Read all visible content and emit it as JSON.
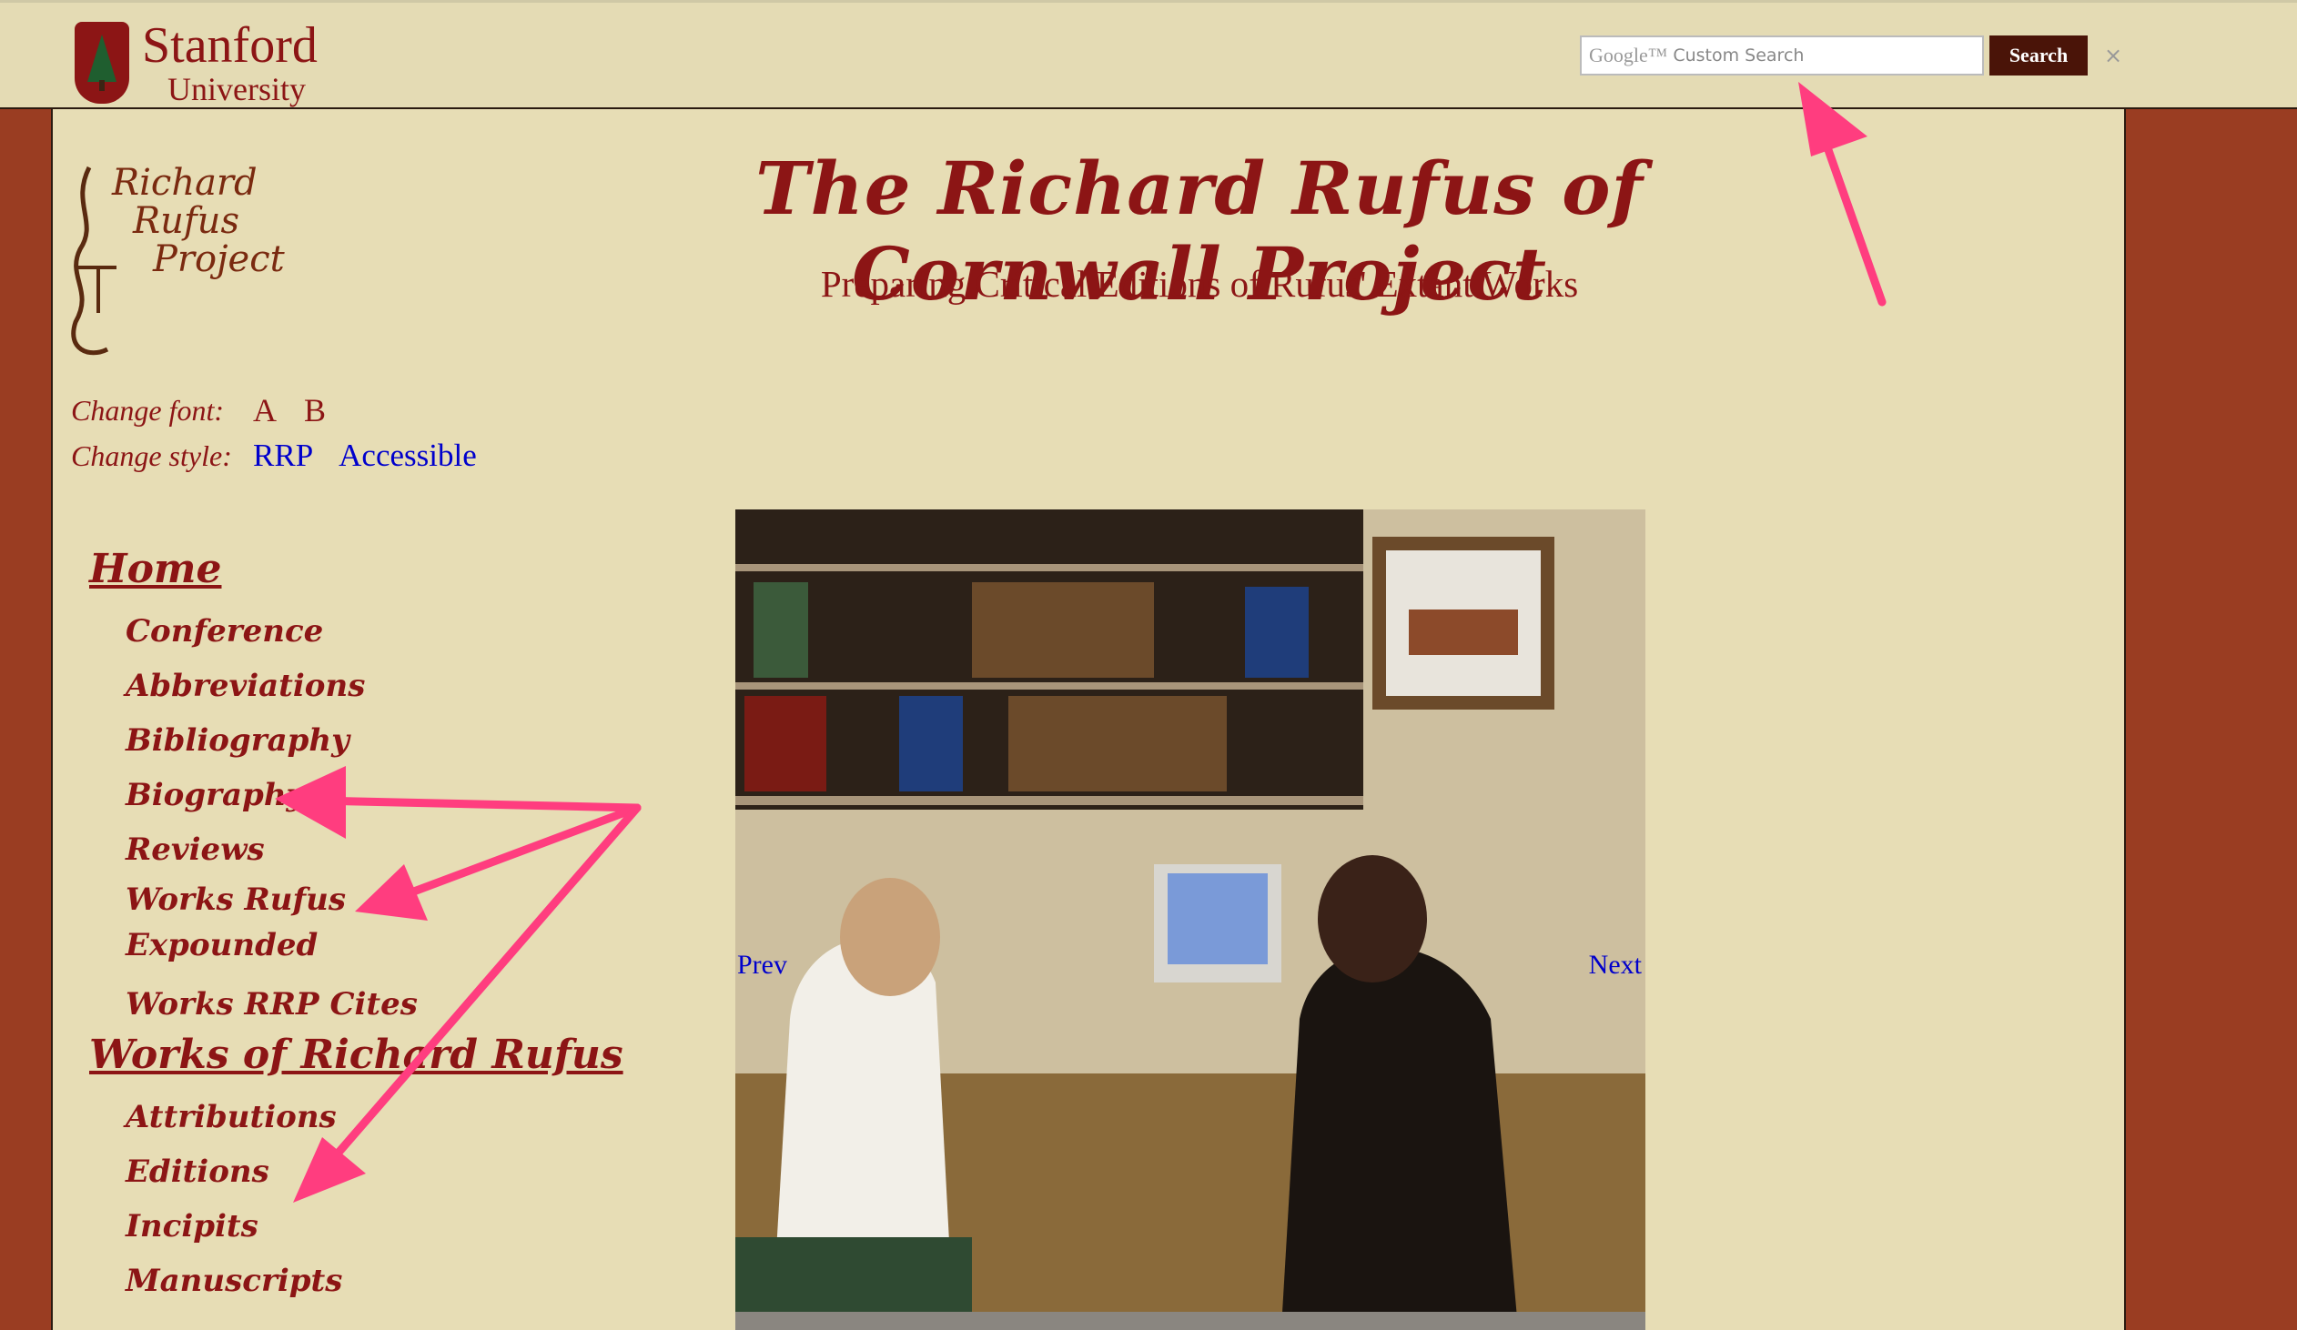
{
  "header": {
    "logo_line1": "Stanford",
    "logo_line2": "University",
    "search": {
      "google_label": "Google™",
      "placeholder": "Custom Search",
      "button_label": "Search",
      "clear_label": "×"
    }
  },
  "site": {
    "logo_lines": [
      "Richard",
      "Rufus",
      "Project"
    ],
    "title": "The Richard Rufus of Cornwall Project",
    "subtitle": "Preparing Critical Editions of Rufus' Extant Works"
  },
  "controls": {
    "font_label": "Change font",
    "font_options": [
      "A",
      "B"
    ],
    "style_label": "Change style",
    "style_options": [
      "RRP",
      "Accessible"
    ]
  },
  "nav": {
    "home": {
      "label": "Home",
      "items": [
        "Conference",
        "Abbreviations",
        "Bibliography",
        "Biography",
        "Reviews",
        "Works Rufus Expounded",
        "Works RRP Cites"
      ]
    },
    "works": {
      "label": "Works of Richard Rufus",
      "items": [
        "Attributions",
        "Editions",
        "Incipits",
        "Manuscripts"
      ]
    }
  },
  "slideshow": {
    "prev_label": "Prev",
    "next_label": "Next"
  },
  "colors": {
    "brand_red": "#8c1515",
    "page_bg": "#e7ddb5",
    "outer_bg": "#9a3d22",
    "link_blue": "#0000cc",
    "annotation_pink": "#ff3d7f"
  }
}
